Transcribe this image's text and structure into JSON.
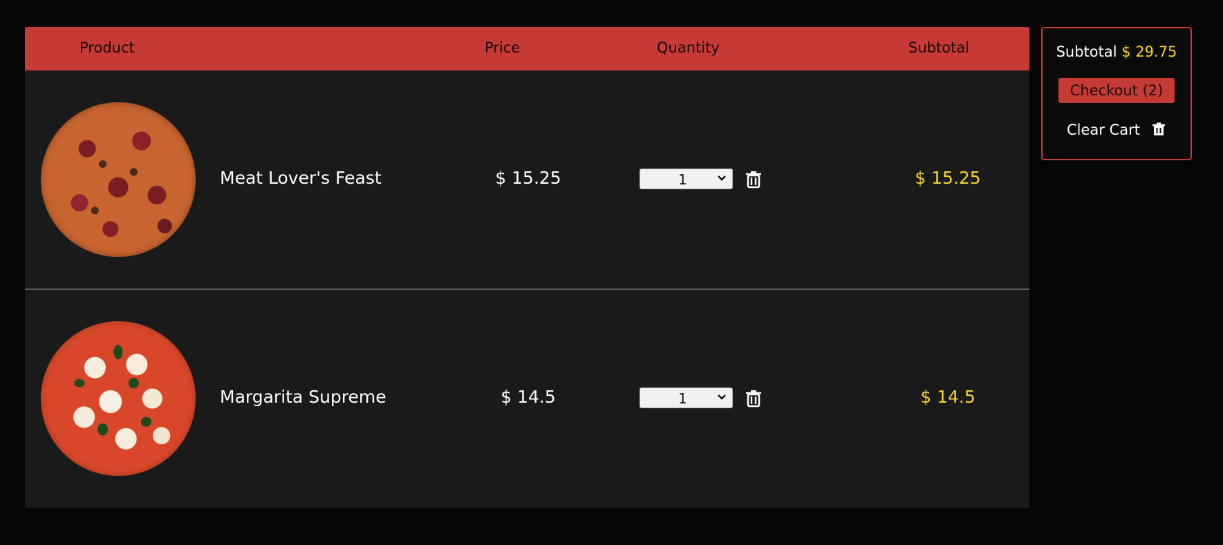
{
  "table": {
    "headers": {
      "product": "Product",
      "price": "Price",
      "quantity": "Quantity",
      "subtotal": "Subtotal"
    },
    "rows": [
      {
        "image_icon": "pizza-meat-lovers-image",
        "name": "Meat Lover's Feast",
        "price": "$ 15.25",
        "quantity": "1",
        "subtotal": "$ 15.25"
      },
      {
        "image_icon": "pizza-margarita-image",
        "name": "Margarita Supreme",
        "price": "$ 14.5",
        "quantity": "1",
        "subtotal": "$ 14.5"
      }
    ]
  },
  "summary": {
    "subtotal_label": "Subtotal",
    "subtotal_value": "$ 29.75",
    "checkout_label": "Checkout (2)",
    "clear_label": "Clear Cart"
  },
  "colors": {
    "accent": "#c53a35",
    "price_highlight": "#f6d42a",
    "panel_bg": "#1a1a1a",
    "page_bg": "#050505"
  }
}
